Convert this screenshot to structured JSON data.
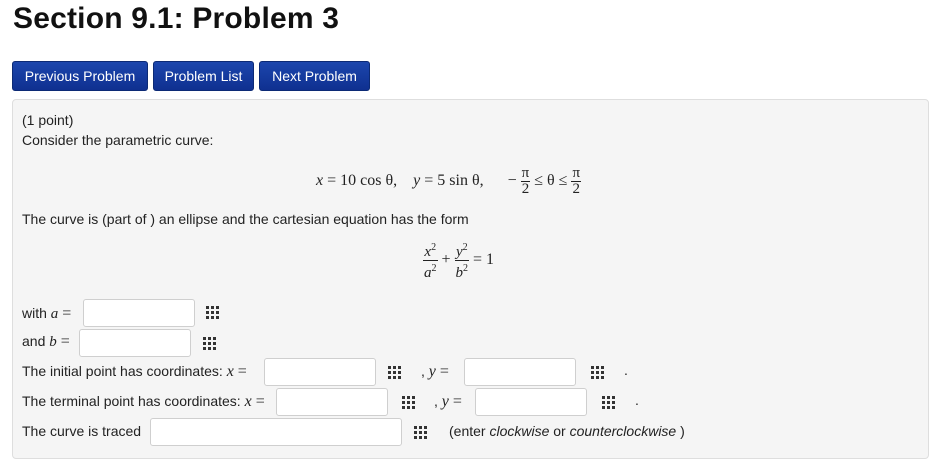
{
  "page": {
    "title": "Section 9.1: Problem 3"
  },
  "nav": {
    "previous": "Previous Problem",
    "list": "Problem List",
    "next": "Next Problem"
  },
  "problem": {
    "points": "(1 point)",
    "intro": "Consider the parametric curve:",
    "equations": {
      "x_lhs": "x",
      "x_rhs": "10 cos θ,",
      "y_lhs": "y",
      "y_rhs": "5 sin θ,",
      "range_minus": "−",
      "pi": "π",
      "two": "2",
      "leq_theta_leq": "≤ θ ≤"
    },
    "ellipse_text": "The curve is (part of ) an ellipse and the cartesian equation has the form",
    "cartesian": {
      "x2": "x",
      "a2": "a",
      "y2": "y",
      "b2": "b",
      "exp": "2",
      "plus": "+",
      "equals_one": "= 1"
    },
    "with_a": {
      "prefix": "with ",
      "var": "a",
      "eq": " ="
    },
    "and_b": {
      "prefix": "and ",
      "var": "b",
      "eq": " ="
    },
    "initial_label": "The initial point has coordinates: ",
    "terminal_label": "The terminal point has coordinates: ",
    "x_var": "x",
    "y_var": "y",
    "eq": " =",
    "comma": ",",
    "period": ".",
    "traced_label": "The curve is traced",
    "hint_open": "(enter ",
    "hint_cw": "clockwise",
    "hint_or": " or ",
    "hint_ccw": "counterclockwise",
    "hint_close": " )"
  },
  "fields": {
    "a_value": "",
    "b_value": "",
    "initial_x": "",
    "initial_y": "",
    "terminal_x": "",
    "terminal_y": "",
    "traced": ""
  }
}
